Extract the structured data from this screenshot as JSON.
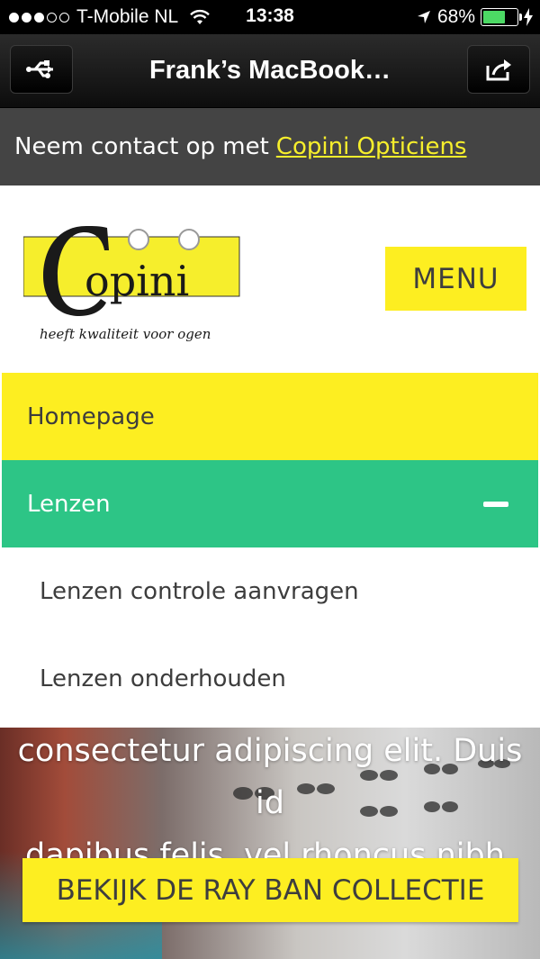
{
  "status_bar": {
    "carrier": "T-Mobile NL",
    "time": "13:38",
    "battery_percent": "68%",
    "battery_level": 0.68,
    "signal_bars_filled": 3,
    "signal_bars_total": 5
  },
  "browser": {
    "title": "Frank’s MacBook…",
    "left_icon": "usb-share-icon",
    "right_icon": "share-icon"
  },
  "contact": {
    "prefix": "Neem contact op met",
    "link": "Copini Opticiens"
  },
  "header": {
    "logo_name": "Copini",
    "logo_tagline": "heeft kwaliteit voor ogen",
    "menu_label": "MENU"
  },
  "menu": {
    "items": [
      {
        "label": "Homepage"
      },
      {
        "label": "Lenzen"
      },
      {
        "label": "Lenzen controle aanvragen"
      },
      {
        "label": "Lenzen onderhouden"
      }
    ]
  },
  "hero": {
    "line1": "consectetur adipiscing elit. Duis id",
    "line2": "dapibus felis, vel rhoncus nibh.",
    "cta": "BEKIJK DE RAY BAN COLLECTIE"
  },
  "colors": {
    "brand_yellow": "#fdee21",
    "accent_green": "#2dc586",
    "contact_bg": "#444444"
  }
}
